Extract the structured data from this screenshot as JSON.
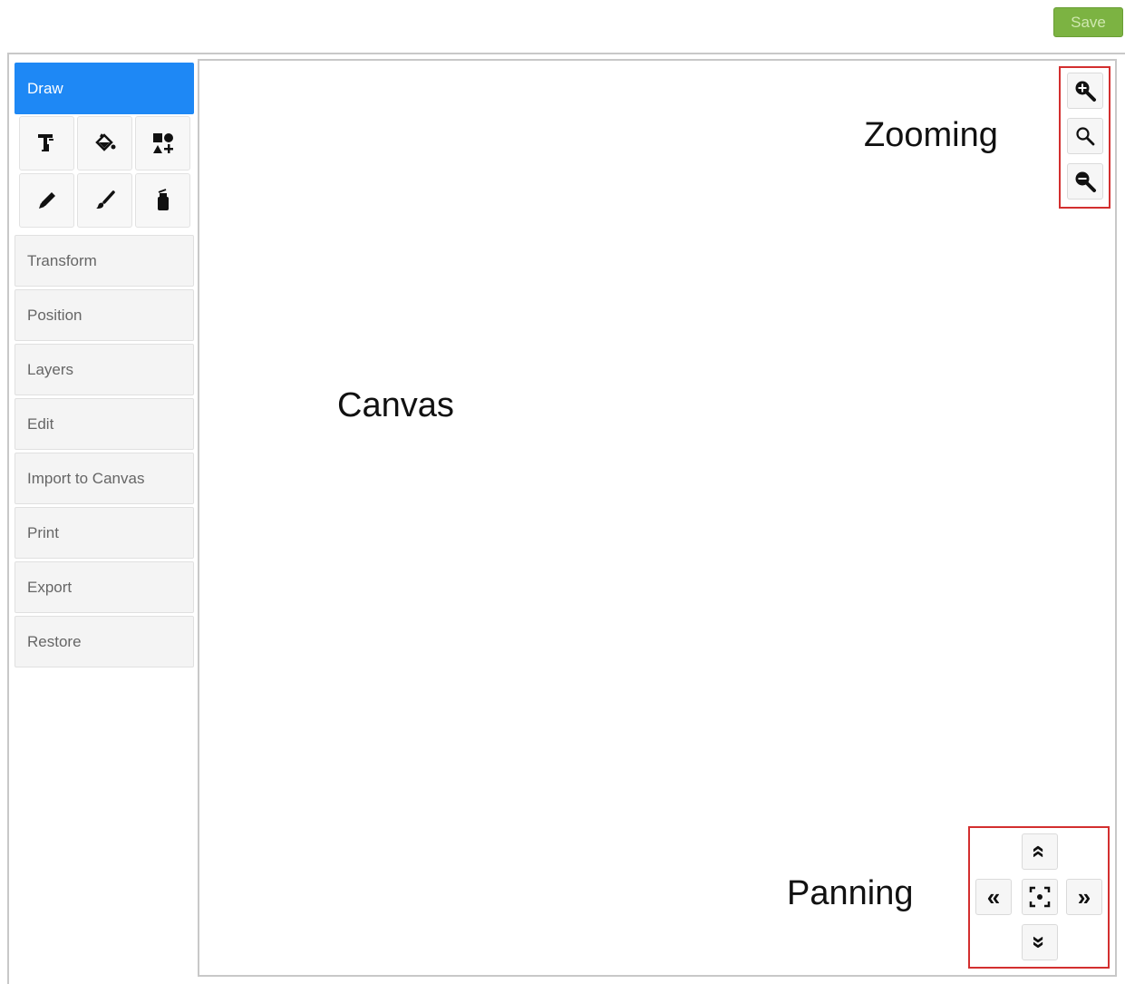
{
  "toolbar": {
    "save_label": "Save"
  },
  "sidebar": {
    "header": "Draw",
    "tools": [
      {
        "name": "text-tool-icon"
      },
      {
        "name": "fill-bucket-icon"
      },
      {
        "name": "shapes-icon"
      },
      {
        "name": "pencil-icon"
      },
      {
        "name": "brush-icon"
      },
      {
        "name": "spray-can-icon"
      }
    ],
    "items": [
      {
        "label": "Transform"
      },
      {
        "label": "Position"
      },
      {
        "label": "Layers"
      },
      {
        "label": "Edit"
      },
      {
        "label": "Import to Canvas"
      },
      {
        "label": "Print"
      },
      {
        "label": "Export"
      },
      {
        "label": "Restore"
      }
    ]
  },
  "canvas": {
    "label": "Canvas",
    "zoom_label": "Zooming",
    "pan_label": "Panning"
  },
  "controls": {
    "zoom": [
      "zoom-in-icon",
      "zoom-reset-icon",
      "zoom-out-icon"
    ],
    "pan": {
      "up": "«",
      "left": "«",
      "right": "»",
      "down": "»",
      "center": "center-icon"
    }
  },
  "colors": {
    "accent": "#1e88f5",
    "save": "#7cb342",
    "highlight": "#d32f2f"
  }
}
